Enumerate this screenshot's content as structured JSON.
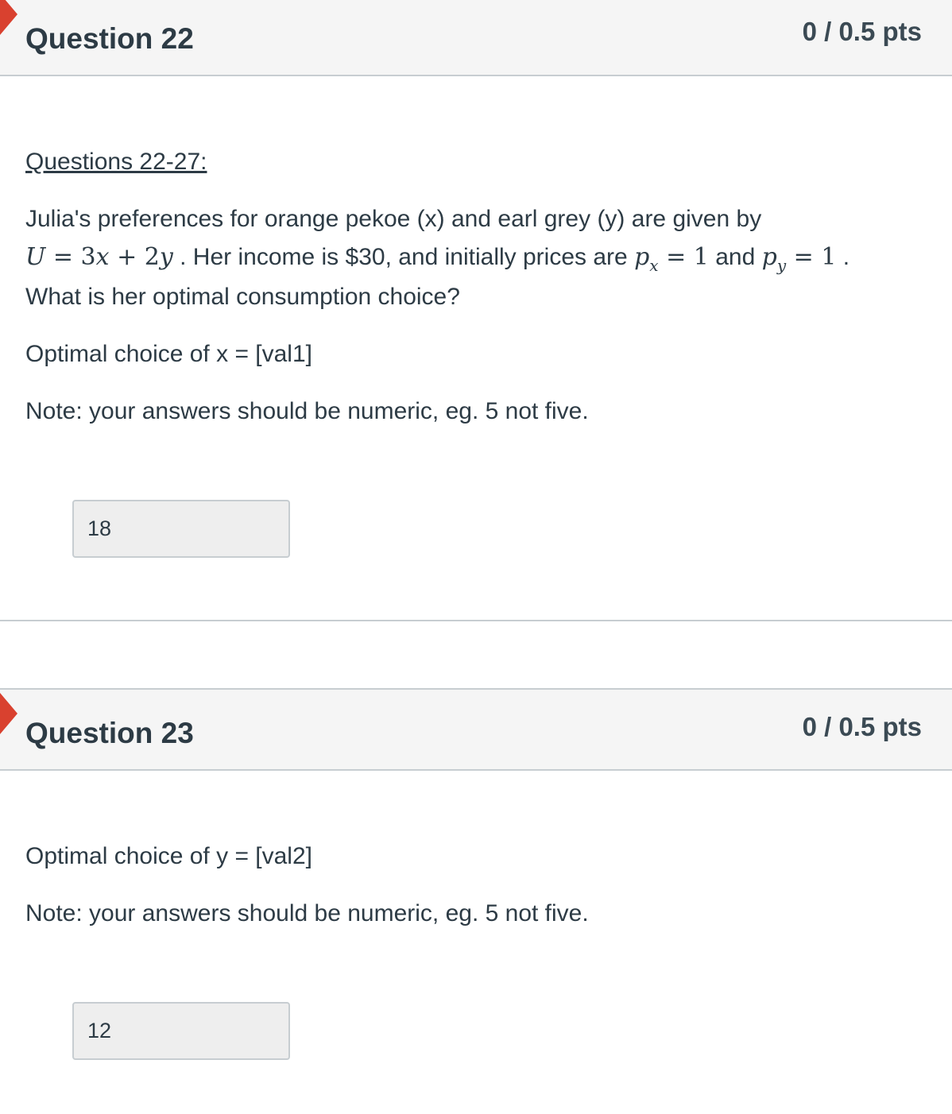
{
  "questions": [
    {
      "title": "Question 22",
      "points": "0 / 0.5 pts",
      "intro": "Questions 22-27:",
      "line1": "Julia's preferences for orange pekoe (x) and earl grey (y) are given by",
      "math_u": "U",
      "math_eq1": " = ",
      "math_3x": "3",
      "math_x": "x",
      "math_plus": " + ",
      "math_2y": "2",
      "math_y": "y",
      "line2_mid": " . Her income is $30, and initially prices are ",
      "px_p": "p",
      "px_sub": "x",
      "px_eq": " = 1",
      "and": " and ",
      "py_p": "p",
      "py_sub": "y",
      "py_eq": " = 1",
      "period": " .",
      "line3": "What is her optimal consumption choice?",
      "prompt": "Optimal choice of x = [val1]",
      "note": "Note: your answers should be numeric, eg. 5 not five.",
      "answer": "18"
    },
    {
      "title": "Question 23",
      "points": "0 / 0.5 pts",
      "prompt": "Optimal choice of y = [val2]",
      "note": "Note: your answers should be numeric, eg. 5 not five.",
      "answer": "12"
    }
  ],
  "colors": {
    "flag": "#d9412f",
    "header_bg": "#f5f5f5",
    "border": "#c7cdd1",
    "text": "#2d3b45"
  }
}
